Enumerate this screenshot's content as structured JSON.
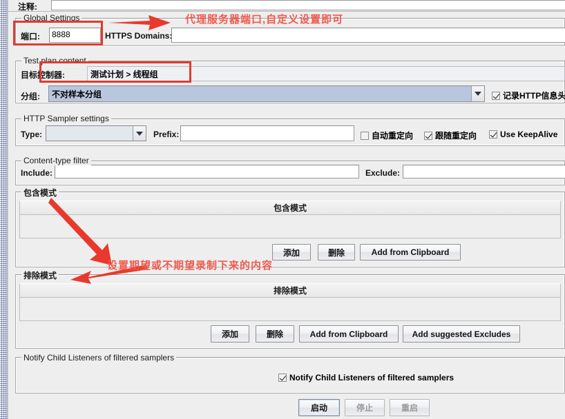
{
  "window": {
    "comment_label": "注释:",
    "comment_value": ""
  },
  "global_settings": {
    "title": "Global Settings",
    "port_label": "端口:",
    "port_value": "8888",
    "https_domains_label": "HTTPS Domains:",
    "https_domains_value": ""
  },
  "test_plan_content": {
    "title": "Test plan content",
    "target_controller_label": "目标控制器:",
    "target_controller_value": "测试计划 > 线程组",
    "grouping_label": "分组:",
    "grouping_value": "不对样本分组",
    "capture_headers_label": "记录HTTP信息头",
    "capture_headers_checked": true
  },
  "http_sampler_settings": {
    "title": "HTTP Sampler settings",
    "type_label": "Type:",
    "type_value": "",
    "prefix_label": "Prefix:",
    "prefix_value": "",
    "auto_redirect_label": "自动重定向",
    "auto_redirect_checked": false,
    "follow_redirect_label": "跟随重定向",
    "follow_redirect_checked": true,
    "keepalive_label": "Use KeepAlive",
    "keepalive_checked": true
  },
  "content_type_filter": {
    "title": "Content-type filter",
    "include_label": "Include:",
    "include_value": "",
    "exclude_label": "Exclude:",
    "exclude_value": ""
  },
  "include_patterns": {
    "title": "包含模式",
    "column_header": "包含模式",
    "rows": [],
    "buttons": [
      {
        "label": "添加",
        "name": "include-add-button"
      },
      {
        "label": "删除",
        "name": "include-delete-button"
      },
      {
        "label": "Add from Clipboard",
        "name": "include-add-from-clipboard-button"
      }
    ]
  },
  "exclude_patterns": {
    "title": "排除模式",
    "column_header": "排除模式",
    "rows": [],
    "buttons": [
      {
        "label": "添加",
        "name": "exclude-add-button"
      },
      {
        "label": "删除",
        "name": "exclude-delete-button"
      },
      {
        "label": "Add from Clipboard",
        "name": "exclude-add-from-clipboard-button"
      },
      {
        "label": "Add suggested Excludes",
        "name": "exclude-add-suggested-button"
      }
    ]
  },
  "notify_child_listeners": {
    "title": "Notify Child Listeners of filtered samplers",
    "checkbox_label": "Notify Child Listeners of filtered samplers",
    "checked": true
  },
  "control_buttons": {
    "start_label": "启动",
    "stop_label": "停止",
    "restart_label": "重启"
  },
  "annotations": {
    "port_note": "代理服务器端口,自定义设置即可",
    "patterns_note": "设置期望或不期望录制下来的内容",
    "accent_color": "#ef5a4e",
    "box_color": "#e03b2f"
  }
}
